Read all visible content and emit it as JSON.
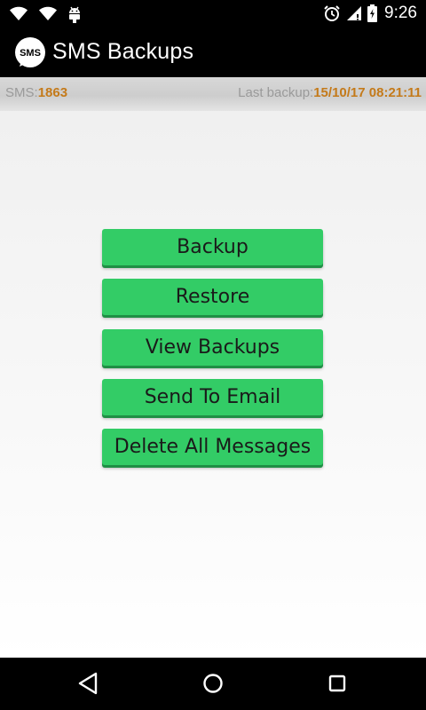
{
  "status_bar": {
    "time": "9:26",
    "icons": [
      "wifi-icon",
      "wifi-icon",
      "android-debug-icon",
      "alarm-icon",
      "signal-icon",
      "battery-icon"
    ]
  },
  "action_bar": {
    "app_icon_text": "SMS",
    "title": "SMS Backups"
  },
  "info_bar": {
    "sms_label": "SMS:",
    "sms_count": "1863",
    "last_backup_label": "Last backup:",
    "last_backup_value": "15/10/17 08:21:11"
  },
  "buttons": {
    "backup": "Backup",
    "restore": "Restore",
    "view_backups": "View Backups",
    "send_to_email": "Send To Email",
    "delete_all": "Delete All Messages"
  },
  "nav_bar": {
    "icons": [
      "back-icon",
      "home-icon",
      "recents-icon"
    ]
  },
  "colors": {
    "button": "#33cc66",
    "accent_value": "#c47a1a"
  }
}
